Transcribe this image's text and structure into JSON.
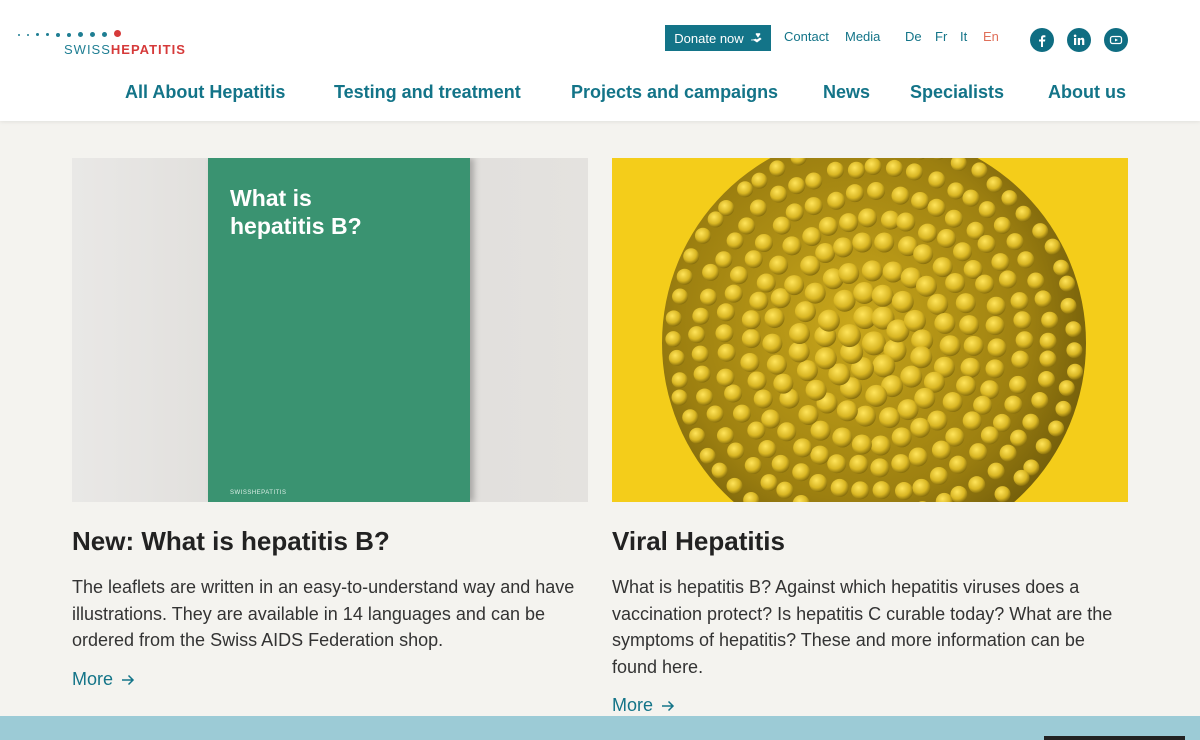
{
  "logo": {
    "swiss": "SWISS",
    "hepatitis": "HEPATITIS",
    "brand_teal": "#1f7e93",
    "brand_red": "#d63a3a"
  },
  "utility": {
    "donate_label": "Donate now",
    "contact_label": "Contact",
    "media_label": "Media",
    "languages": [
      "De",
      "Fr",
      "It",
      "En"
    ],
    "active_language": "En"
  },
  "social": {
    "facebook": "facebook-icon",
    "linkedin": "linkedin-icon",
    "youtube": "youtube-icon"
  },
  "nav": [
    "All About Hepatitis",
    "Testing and treatment",
    "Projects and campaigns",
    "News",
    "Specialists",
    "About us"
  ],
  "cards": [
    {
      "image_caption": "What is\nhepatitis B?",
      "image_brand": "SWISSHEPATITIS",
      "title": "New: What is hepatitis B?",
      "text": "The leaflets are written in an easy-to-understand way and have illustrations. They are available in 14 languages and can be ordered from the Swiss AIDS Federation shop.",
      "more_label": "More"
    },
    {
      "title": "Viral Hepatitis",
      "text": "What is hepatitis B? Against which hepatitis viruses does a vaccination protect? Is hepatitis C curable today? What are the symptoms of hepatitis? These and more information can be found here.",
      "more_label": "More"
    }
  ],
  "colors": {
    "accent": "#137488",
    "background": "#f4f3ef",
    "virus_bg": "#f4cd1a",
    "leaflet_green": "#3a9371",
    "footer": "#9ccbd6"
  }
}
